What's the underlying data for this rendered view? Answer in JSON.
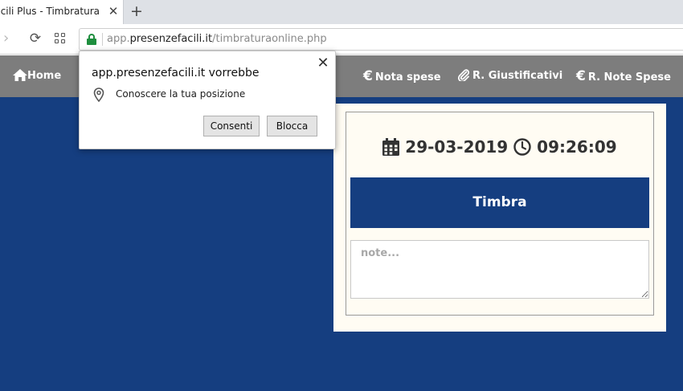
{
  "browser": {
    "tab_title": "Presenze Facili Plus - Timbratura",
    "url_prefix": "app.",
    "url_domain": "presenzefacili.it",
    "url_path": "/timbraturaonline.php"
  },
  "navbar": {
    "home": "Home",
    "nota_spese": "Nota spese",
    "giustificativi": "R. Giustificativi",
    "note_spese": "R. Note Spese",
    "euro_symbol": "€"
  },
  "timbratura": {
    "date": "29-03-2019",
    "time": "09:26:09",
    "button_label": "Timbra",
    "note_placeholder": "note..."
  },
  "permission_popup": {
    "title": "app.presenzefacili.it vorrebbe",
    "message": "Conoscere la tua posizione",
    "allow_label": "Consenti",
    "block_label": "Blocca",
    "close_symbol": "✕"
  },
  "colors": {
    "navbar_bg": "#7d7d7d",
    "main_bg": "#153e80",
    "card_bg": "#fffcf3",
    "lock_green": "#1e8e3e"
  }
}
